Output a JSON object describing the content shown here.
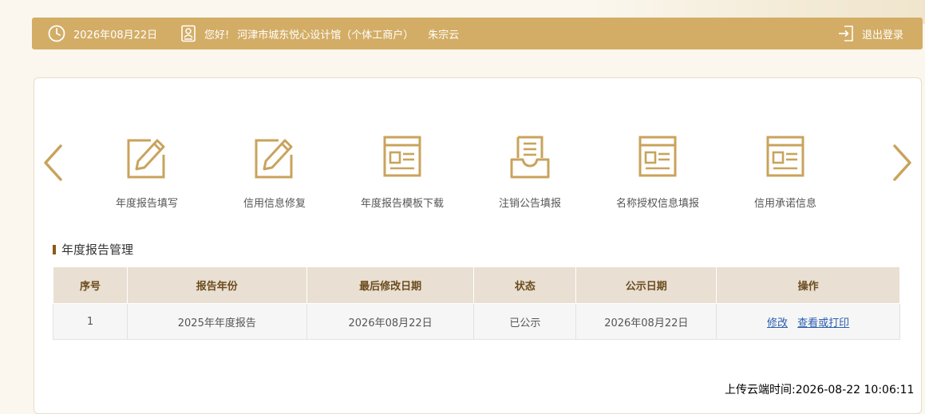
{
  "topbar": {
    "date": "2026年08月22日",
    "greeting": "您好!",
    "company": "河津市城东悦心设计馆（个体工商户）",
    "person": "朱宗云",
    "logout": "退出登录"
  },
  "nav": {
    "items": [
      {
        "label": "年度报告填写",
        "icon": "pencil-edit-icon"
      },
      {
        "label": "信用信息修复",
        "icon": "pencil-edit-icon"
      },
      {
        "label": "年度报告模板下载",
        "icon": "document-template-icon"
      },
      {
        "label": "注销公告填报",
        "icon": "inbox-tray-icon"
      },
      {
        "label": "名称授权信息填报",
        "icon": "document-template-icon"
      },
      {
        "label": "信用承诺信息",
        "icon": "document-template-icon"
      }
    ]
  },
  "section": {
    "title": "年度报告管理"
  },
  "table": {
    "headers": [
      "序号",
      "报告年份",
      "最后修改日期",
      "状态",
      "公示日期",
      "操作"
    ],
    "rows": [
      {
        "index": "1",
        "year": "2025年年度报告",
        "modified": "2026年08月22日",
        "status": "已公示",
        "published": "2026年08月22日",
        "action_edit": "修改",
        "action_view": "查看或打印"
      }
    ]
  },
  "footer": {
    "upload_time": "上传云端时间:2026-08-22 10:06:11"
  },
  "colors": {
    "accent": "#d3ad66",
    "icon": "#c9a35c"
  }
}
